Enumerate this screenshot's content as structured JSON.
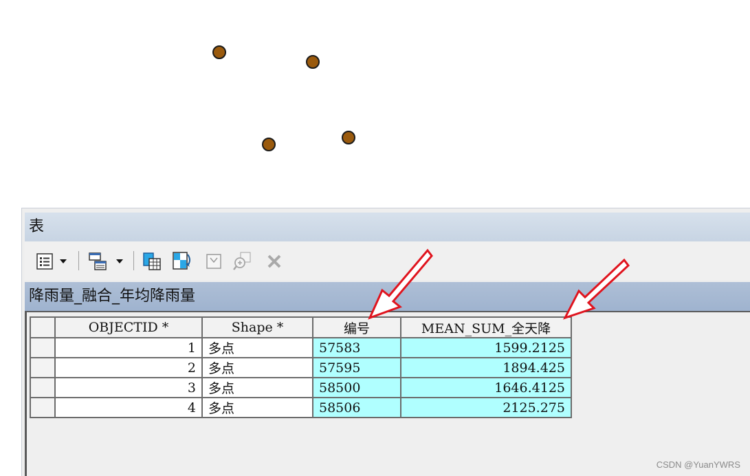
{
  "map": {
    "points": [
      {
        "name": "point-1"
      },
      {
        "name": "point-2"
      },
      {
        "name": "point-3"
      },
      {
        "name": "point-4"
      }
    ],
    "point_color": "#9a5a0d"
  },
  "window": {
    "title": "表"
  },
  "toolbar": {
    "icons": [
      "table-options-icon",
      "dropdown-arrow-icon",
      "related-tables-icon",
      "dropdown-arrow-icon",
      "select-by-attributes-icon",
      "switch-selection-icon",
      "clear-selection-icon",
      "zoom-to-selected-icon",
      "delete-selected-icon"
    ]
  },
  "table_tab": {
    "label": "降雨量_融合_年均降雨量"
  },
  "table": {
    "headers": [
      "OBJECTID *",
      "Shape *",
      "编号",
      "MEAN_SUM_全天降"
    ],
    "rows": [
      {
        "objectid": "1",
        "shape": "多点",
        "code": "57583",
        "mean": "1599.2125"
      },
      {
        "objectid": "2",
        "shape": "多点",
        "code": "57595",
        "mean": "1894.425"
      },
      {
        "objectid": "3",
        "shape": "多点",
        "code": "58500",
        "mean": "1646.4125"
      },
      {
        "objectid": "4",
        "shape": "多点",
        "code": "58506",
        "mean": "2125.275"
      }
    ],
    "highlight_color": "#b0ffff"
  },
  "watermark": "CSDN @YuanYWRS",
  "annotation_color": "#e0141e"
}
